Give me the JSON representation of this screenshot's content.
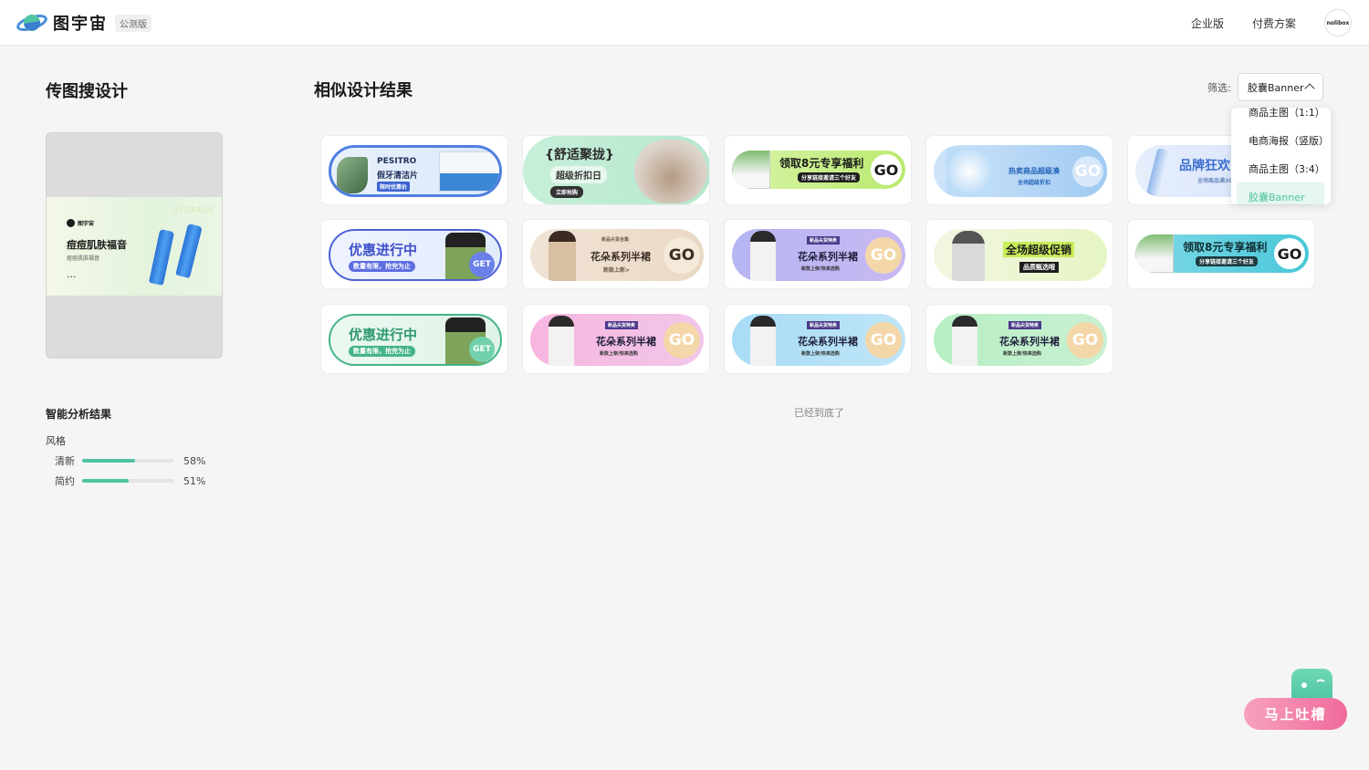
{
  "header": {
    "logo_text": "图宇宙",
    "beta_badge": "公测版",
    "nav": [
      {
        "label": "企业版"
      },
      {
        "label": "付费方案"
      }
    ],
    "avatar_text": "nolibox"
  },
  "left": {
    "title": "传图搜设计",
    "preview": {
      "brand": "图宇宙",
      "headline": "痘痘肌肤福音",
      "sub": "痘痘肌肤福音",
      "ellipsis": "...",
      "upgrade": "UPGRADE"
    },
    "analysis_title": "智能分析结果",
    "style_label": "风格",
    "styles": [
      {
        "name": "清新",
        "value": 58,
        "pct": "58%"
      },
      {
        "name": "简约",
        "value": 51,
        "pct": "51%"
      }
    ]
  },
  "right": {
    "title": "相似设计结果",
    "filter_label": "筛选:",
    "filter_value": "胶囊Banner",
    "end_text": "已经到底了"
  },
  "dropdown": {
    "options": [
      {
        "label": "商品主图（1:1）"
      },
      {
        "label": "电商海报（竖版）"
      },
      {
        "label": "商品主图（3:4）"
      },
      {
        "label": "胶囊Banner"
      }
    ]
  },
  "cards": [
    {
      "title": "PESITRO",
      "sub": "假牙清洁片",
      "tag": "限时优惠价"
    },
    {
      "title": "{舒适聚拢}",
      "sub": "超级折扣日",
      "tag": "立即抢购"
    },
    {
      "title": "领取8元专享福利",
      "sub": "分享链接邀请三个好友",
      "go": "GO"
    },
    {
      "title": "热卖商品超级凑",
      "sub": "全场超级折扣",
      "go": "GO"
    },
    {
      "title": "品牌狂欢",
      "sub": "全场商品满300"
    },
    {
      "title": "优惠进行中",
      "sub": "数量有限，抢完为止",
      "go": "GET"
    },
    {
      "title": "花朵系列半裙",
      "sub": "新款上新>",
      "tag": "新品尖货合集",
      "go": "GO"
    },
    {
      "title": "花朵系列半裙",
      "sub": "新款上架/快来选购",
      "tag": "新品尖货特卖",
      "go": "GO"
    },
    {
      "title": "全场超级促销",
      "sub": "品质甄选哦"
    },
    {
      "title": "领取8元专享福利",
      "sub": "分享链接邀请三个好友",
      "go": "GO"
    },
    {
      "title": "优惠进行中",
      "sub": "数量有限，抢完为止",
      "go": "GET"
    },
    {
      "title": "花朵系列半裙",
      "sub": "新款上架/快来选购",
      "tag": "新品尖货特卖",
      "go": "GO"
    },
    {
      "title": "花朵系列半裙",
      "sub": "新款上架/快来选购",
      "tag": "新品尖货特卖",
      "go": "GO"
    },
    {
      "title": "花朵系列半裙",
      "sub": "新款上架/快来选购",
      "tag": "新品尖货特卖",
      "go": "GO"
    }
  ],
  "feedback": {
    "label": "马上吐槽"
  },
  "colors": {
    "accent": "#4fc4a3",
    "feedback_pink": "#f06b9b"
  }
}
